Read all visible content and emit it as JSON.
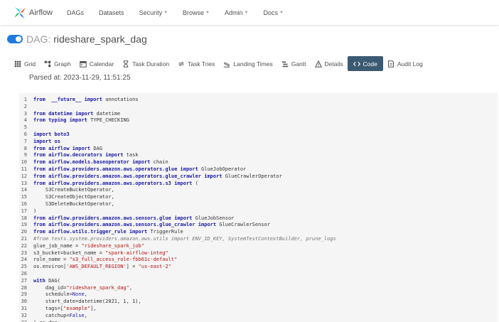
{
  "navbar": {
    "brand": "Airflow",
    "items": [
      {
        "label": "DAGs",
        "dropdown": false
      },
      {
        "label": "Datasets",
        "dropdown": false
      },
      {
        "label": "Security",
        "dropdown": true
      },
      {
        "label": "Browse",
        "dropdown": true
      },
      {
        "label": "Admin",
        "dropdown": true
      },
      {
        "label": "Docs",
        "dropdown": true
      }
    ]
  },
  "dag": {
    "prefix": "DAG:",
    "name": "rideshare_spark_dag",
    "paused": false
  },
  "tabs": [
    {
      "label": "Grid",
      "icon": "grid-icon",
      "active": false
    },
    {
      "label": "Graph",
      "icon": "graph-icon",
      "active": false
    },
    {
      "label": "Calendar",
      "icon": "calendar-icon",
      "active": false
    },
    {
      "label": "Task Duration",
      "icon": "hourglass-icon",
      "active": false
    },
    {
      "label": "Task Tries",
      "icon": "retry-icon",
      "active": false
    },
    {
      "label": "Landing Times",
      "icon": "landing-icon",
      "active": false
    },
    {
      "label": "Gantt",
      "icon": "gantt-icon",
      "active": false
    },
    {
      "label": "Details",
      "icon": "warning-icon",
      "active": false
    },
    {
      "label": "Code",
      "icon": "code-icon",
      "active": true
    },
    {
      "label": "Audit Log",
      "icon": "log-icon",
      "active": false
    }
  ],
  "parsed_at": "Parsed at: 2023-11-29, 11:51:25",
  "colors": {
    "accent": "#1f7ae0",
    "active_tab": "#3d5a73",
    "keyword": "#1a1aa6",
    "string": "#b31212"
  },
  "code_lines": [
    [
      [
        "kw",
        "from"
      ],
      [
        "",
        "  "
      ],
      [
        "kw",
        "__future__"
      ],
      [
        "",
        ""
      ],
      [
        "kw",
        " import"
      ],
      [
        "",
        " annotations"
      ]
    ],
    [],
    [
      [
        "kw",
        "from"
      ],
      [
        "",
        " "
      ],
      [
        "kw",
        "datetime"
      ],
      [
        "kw",
        " import"
      ],
      [
        "",
        " datetime"
      ]
    ],
    [
      [
        "kw",
        "from"
      ],
      [
        "",
        " "
      ],
      [
        "kw",
        "typing"
      ],
      [
        "kw",
        " import"
      ],
      [
        "",
        " TYPE_CHECKING"
      ]
    ],
    [],
    [
      [
        "kw",
        "import"
      ],
      [
        "",
        " "
      ],
      [
        "kw",
        "boto3"
      ]
    ],
    [
      [
        "kw",
        "import"
      ],
      [
        "",
        " "
      ],
      [
        "kw",
        "os"
      ]
    ],
    [
      [
        "kw",
        "from"
      ],
      [
        "",
        " "
      ],
      [
        "kw",
        "airflow"
      ],
      [
        "kw",
        " import"
      ],
      [
        "",
        " DAG"
      ]
    ],
    [
      [
        "kw",
        "from"
      ],
      [
        "",
        " "
      ],
      [
        "kw",
        "airflow.decorators"
      ],
      [
        "kw",
        " import"
      ],
      [
        "",
        " task"
      ]
    ],
    [
      [
        "kw",
        "from"
      ],
      [
        "",
        " "
      ],
      [
        "kw",
        "airflow.models.baseoperator"
      ],
      [
        "kw",
        " import"
      ],
      [
        "",
        " chain"
      ]
    ],
    [
      [
        "kw",
        "from"
      ],
      [
        "",
        " "
      ],
      [
        "kw",
        "airflow.providers.amazon.aws.operators.glue"
      ],
      [
        "kw",
        " import"
      ],
      [
        "",
        " GlueJobOperator"
      ]
    ],
    [
      [
        "kw",
        "from"
      ],
      [
        "",
        " "
      ],
      [
        "kw",
        "airflow.providers.amazon.aws.operators.glue_crawler"
      ],
      [
        "kw",
        " import"
      ],
      [
        "",
        " GlueCrawlerOperator"
      ]
    ],
    [
      [
        "kw",
        "from"
      ],
      [
        "",
        " "
      ],
      [
        "kw",
        "airflow.providers.amazon.aws.operators.s3"
      ],
      [
        "kw",
        " import"
      ],
      [
        "",
        " ("
      ]
    ],
    [
      [
        "",
        "    S3CreateBucketOperator,"
      ]
    ],
    [
      [
        "",
        "    S3CreateObjectOperator,"
      ]
    ],
    [
      [
        "",
        "    S3DeleteBucketOperator,"
      ]
    ],
    [
      [
        "",
        ")"
      ]
    ],
    [
      [
        "kw",
        "from"
      ],
      [
        "",
        " "
      ],
      [
        "kw",
        "airflow.providers.amazon.aws.sensors.glue"
      ],
      [
        "kw",
        " import"
      ],
      [
        "",
        " GlueJobSensor"
      ]
    ],
    [
      [
        "kw",
        "from"
      ],
      [
        "",
        " "
      ],
      [
        "kw",
        "airflow.providers.amazon.aws.sensors.glue_crawler"
      ],
      [
        "kw",
        " import"
      ],
      [
        "",
        " GlueCrawlerSensor"
      ]
    ],
    [
      [
        "kw",
        "from"
      ],
      [
        "",
        " "
      ],
      [
        "kw",
        "airflow.utils.trigger_rule"
      ],
      [
        "kw",
        " import"
      ],
      [
        "",
        " TriggerRule"
      ]
    ],
    [
      [
        "cm",
        "#from tests.system.providers.amazon.aws.utils import ENV_ID_KEY, SystemTestContextBuilder, prune_logs"
      ]
    ],
    [
      [
        "",
        "glue_job_name = "
      ],
      [
        "st",
        "\"rideshare_spark_job\""
      ]
    ],
    [
      [
        "",
        "s3_bucket=bucket_name = "
      ],
      [
        "st",
        "\"spark-airflow-integ\""
      ]
    ],
    [
      [
        "",
        "role_name = "
      ],
      [
        "st",
        "\"s3_full_access_role-fbb61c-default\""
      ]
    ],
    [
      [
        "",
        "os.environ["
      ],
      [
        "st",
        "'AWS_DEFAULT_REGION'"
      ],
      [
        "",
        "] = "
      ],
      [
        "st",
        "\"us-east-2\""
      ]
    ],
    [],
    [
      [
        "kw",
        "with"
      ],
      [
        "",
        " DAG("
      ]
    ],
    [
      [
        "",
        "    dag_id="
      ],
      [
        "st",
        "\"rideshare_spark_dag\""
      ],
      [
        "",
        ","
      ]
    ],
    [
      [
        "",
        "    schedule="
      ],
      [
        "cn",
        "None"
      ],
      [
        "",
        ","
      ]
    ],
    [
      [
        "",
        "    start_date=datetime(2021, 1, 1),"
      ]
    ],
    [
      [
        "",
        "    tags=["
      ],
      [
        "st",
        "\"example\""
      ],
      [
        "",
        "],"
      ]
    ],
    [
      [
        "",
        "    catchup="
      ],
      [
        "cn",
        "False"
      ],
      [
        "",
        ","
      ]
    ],
    [
      [
        "",
        ") as dag:"
      ]
    ]
  ]
}
